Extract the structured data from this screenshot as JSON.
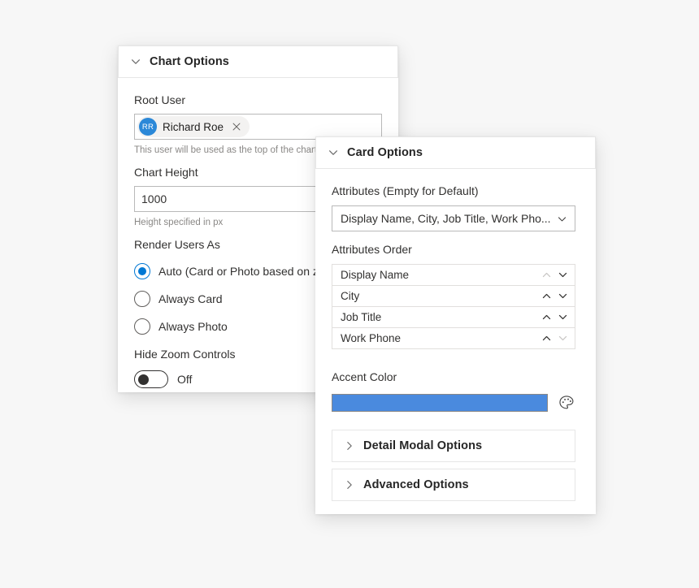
{
  "chart_options_panel": {
    "header": {
      "title": "Chart Options",
      "chevron": "chevron-down-icon"
    },
    "root_user": {
      "label": "Root User",
      "person": {
        "initials": "RR",
        "name": "Richard Roe",
        "remove_icon": "close-icon",
        "avatar_color": "#2b88d8"
      },
      "helper": "This user will be used as the top of the chart"
    },
    "chart_height": {
      "label": "Chart Height",
      "value": "1000",
      "helper": "Height specified in px"
    },
    "render_users_as": {
      "label": "Render Users As",
      "options": [
        {
          "label": "Auto (Card or Photo based on zoom)",
          "selected": true
        },
        {
          "label": "Always Card",
          "selected": false
        },
        {
          "label": "Always Photo",
          "selected": false
        }
      ],
      "accent_color": "#0078d4"
    },
    "hide_zoom_controls": {
      "label": "Hide Zoom Controls",
      "state_text": "Off",
      "checked": false
    }
  },
  "card_options_panel": {
    "header": {
      "title": "Card Options",
      "chevron": "chevron-down-icon"
    },
    "attributes": {
      "label": "Attributes (Empty for Default)",
      "value": "Display Name, City, Job Title, Work Pho...",
      "chevron": "chevron-down-icon"
    },
    "attributes_order": {
      "label": "Attributes Order",
      "items": [
        {
          "label": "Display Name",
          "up_disabled": true,
          "down_disabled": false
        },
        {
          "label": "City",
          "up_disabled": false,
          "down_disabled": false
        },
        {
          "label": "Job Title",
          "up_disabled": false,
          "down_disabled": false
        },
        {
          "label": "Work Phone",
          "up_disabled": false,
          "down_disabled": true
        }
      ],
      "up_icon": "chevron-up-icon",
      "down_icon": "chevron-down-icon"
    },
    "accent_color": {
      "label": "Accent Color",
      "value": "#4a8ade",
      "picker_icon": "palette-icon"
    }
  },
  "collapsed_sections": [
    {
      "title": "Detail Modal Options",
      "chevron": "chevron-right-icon"
    },
    {
      "title": "Advanced Options",
      "chevron": "chevron-right-icon"
    }
  ]
}
